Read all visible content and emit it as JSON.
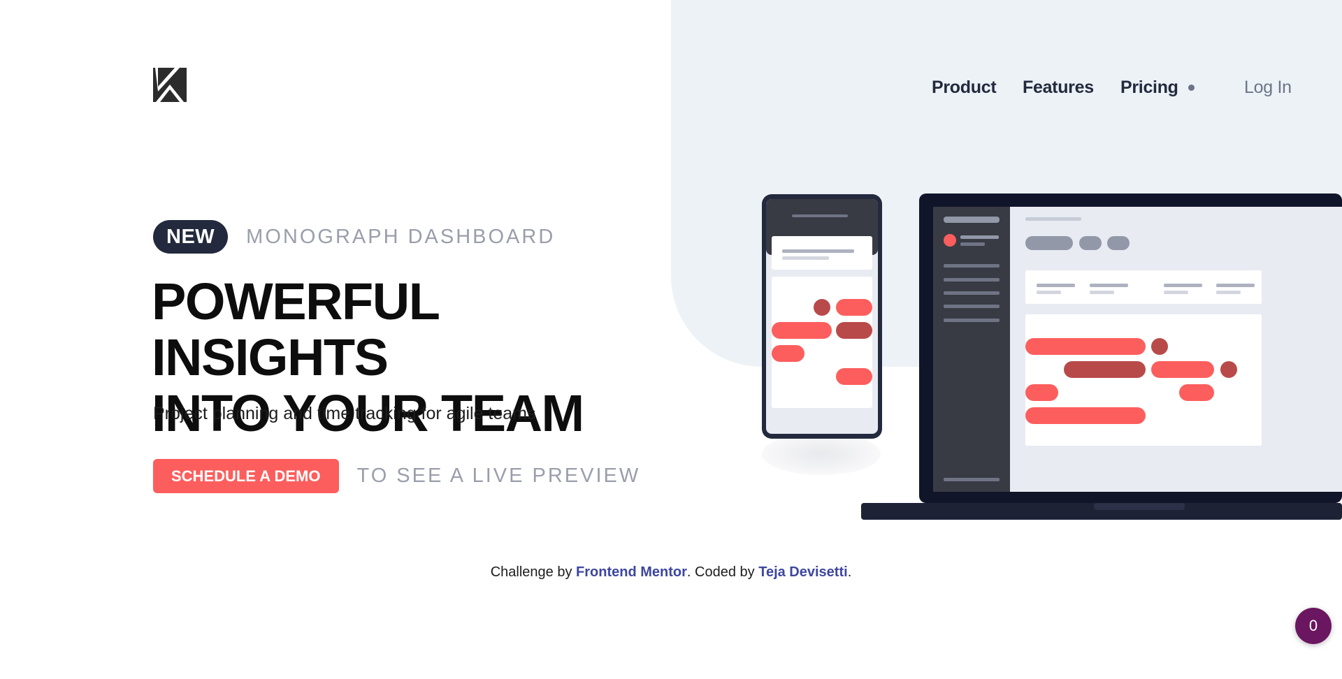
{
  "nav": {
    "items": [
      "Product",
      "Features",
      "Pricing"
    ],
    "login": "Log In"
  },
  "hero": {
    "badge": "NEW",
    "badge_caption": "MONOGRAPH DASHBOARD",
    "headline_line1": "POWERFUL INSIGHTS",
    "headline_line2": "INTO YOUR TEAM",
    "subtitle": "Project planning and time tracking for agile teams",
    "cta_label": "SCHEDULE A DEMO",
    "cta_caption": "TO SEE A LIVE PREVIEW"
  },
  "footer": {
    "prefix": "Challenge by ",
    "link1": "Frontend Mentor",
    "middle": ". Coded by ",
    "link2": "Teja Devisetti",
    "suffix": "."
  },
  "counter": {
    "value": "0"
  },
  "colors": {
    "accent": "#fc5e5d",
    "dark": "#232a3e",
    "muted": "#9a9eab",
    "panel": "#edf2f6",
    "link": "#3d46a0",
    "counter_bg": "#6b1660"
  },
  "icons": {
    "logo": "monograph-logo-icon"
  }
}
